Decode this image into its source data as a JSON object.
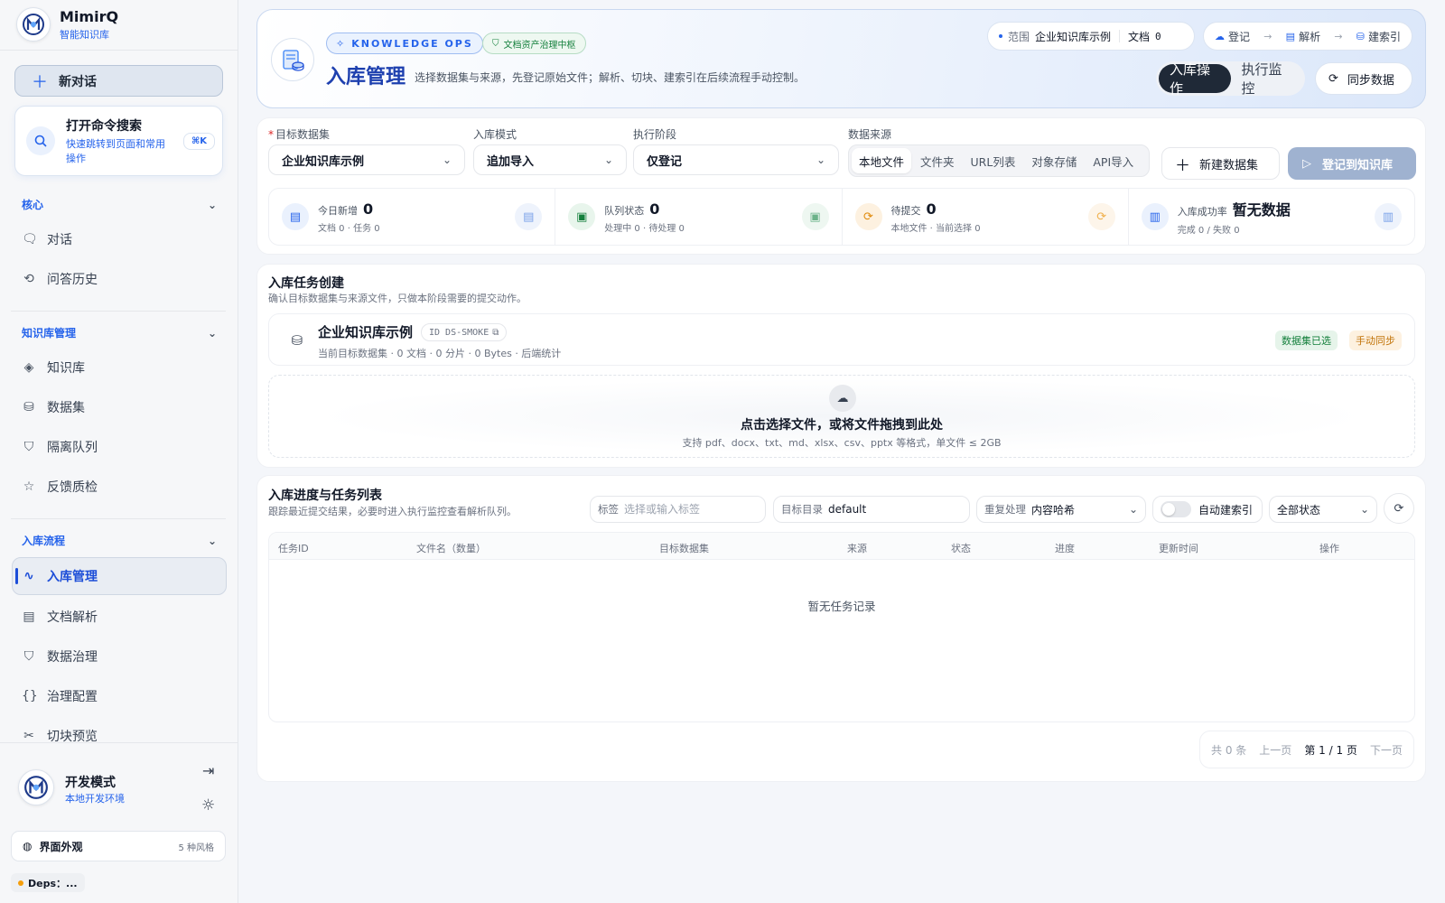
{
  "sidebar": {
    "brand": {
      "title": "MimirQ",
      "subtitle": "智能知识库"
    },
    "new_chat": "新对话",
    "command": {
      "title": "打开命令搜索",
      "subtitle": "快速跳转到页面和常用操作",
      "shortcut": "⌘K"
    },
    "sections": {
      "core": {
        "label": "核心",
        "items": [
          "对话",
          "问答历史"
        ]
      },
      "kb": {
        "label": "知识库管理",
        "items": [
          "知识库",
          "数据集",
          "隔离队列",
          "反馈质检"
        ]
      },
      "ingest": {
        "label": "入库流程",
        "items": [
          "入库管理",
          "文档解析",
          "数据治理",
          "治理配置",
          "切块预览"
        ]
      }
    },
    "dev": {
      "title": "开发模式",
      "subtitle": "本地开发环境"
    },
    "appearance": {
      "label": "界面外观",
      "count": "5 种风格"
    },
    "deps": "Deps：..."
  },
  "header": {
    "badge_ops": "KNOWLEDGE OPS",
    "badge_gov": "文档资产治理中枢",
    "title": "入库管理",
    "desc": "选择数据集与来源，先登记原始文件；解析、切块、建索引在后续流程手动控制。",
    "scope_label": "范围",
    "scope_value": "企业知识库示例",
    "doc_label": "文档",
    "doc_value": "0",
    "flow": [
      "登记",
      "解析",
      "建索引"
    ],
    "mode_tabs": [
      "入库操作",
      "执行监控"
    ],
    "sync": "同步数据"
  },
  "config": {
    "dataset_label": "目标数据集",
    "dataset_value": "企业知识库示例",
    "mode_label": "入库模式",
    "mode_value": "追加导入",
    "stage_label": "执行阶段",
    "stage_value": "仅登记",
    "source_label": "数据来源",
    "sources": [
      "本地文件",
      "文件夹",
      "URL列表",
      "对象存储",
      "API导入"
    ],
    "new_dataset": "新建数据集",
    "register": "登记到知识库"
  },
  "stats": [
    {
      "label": "今日新增",
      "value": "0",
      "sub": "文档 0 · 任务 0"
    },
    {
      "label": "队列状态",
      "value": "0",
      "sub": "处理中 0 · 待处理 0"
    },
    {
      "label": "待提交",
      "value": "0",
      "sub": "本地文件 · 当前选择 0"
    },
    {
      "label": "入库成功率",
      "value": "暂无数据",
      "sub": "完成 0 / 失败 0"
    }
  ],
  "create": {
    "title": "入库任务创建",
    "subtitle": "确认目标数据集与来源文件，只做本阶段需要的提交动作。",
    "ds_name": "企业知识库示例",
    "ds_id": "ID DS-SMOKE",
    "ds_meta": "当前目标数据集 · 0 文档 · 0 分片 · 0 Bytes · 后端统计",
    "tag_selected": "数据集已选",
    "tag_manual": "手动同步",
    "drop_title": "点击选择文件，或将文件拖拽到此处",
    "drop_sub": "支持 pdf、docx、txt、md、xlsx、csv、pptx 等格式，单文件 ≤ 2GB"
  },
  "tasks": {
    "title": "入库进度与任务列表",
    "subtitle": "跟踪最近提交结果，必要时进入执行监控查看解析队列。",
    "tag_label": "标签",
    "tag_placeholder": "选择或输入标签",
    "dir_label": "目标目录",
    "dir_value": "default",
    "dup_label": "重复处理",
    "dup_value": "内容哈希",
    "auto_index": "自动建索引",
    "status_filter": "全部状态",
    "columns": [
      "任务ID",
      "文件名（数量）",
      "目标数据集",
      "来源",
      "状态",
      "进度",
      "更新时间",
      "操作"
    ],
    "empty": "暂无任务记录",
    "pager": {
      "total": "共 0 条",
      "prev": "上一页",
      "current": "第 1 / 1 页",
      "next": "下一页"
    }
  },
  "colors": {
    "accent": "#2563eb",
    "title": "#1e40af",
    "green": "#15803d",
    "orange": "#c2740a"
  }
}
